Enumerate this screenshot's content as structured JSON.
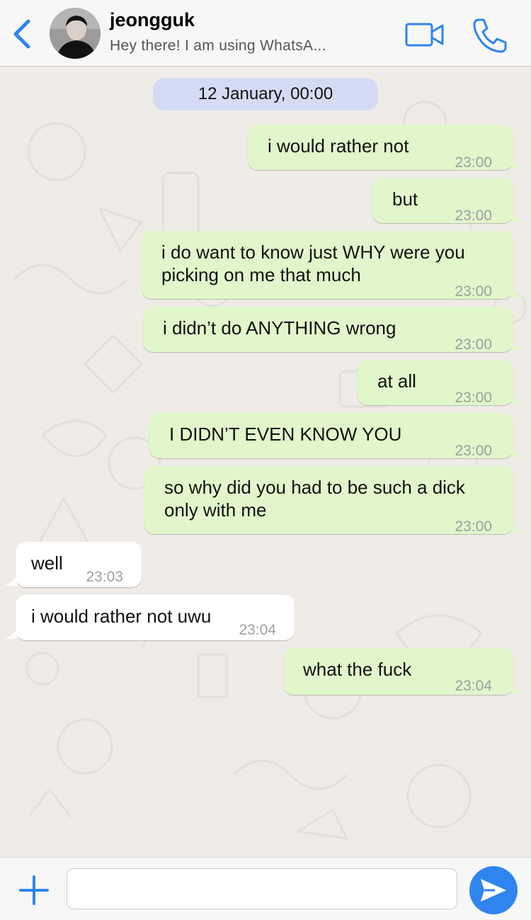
{
  "header": {
    "contact_name": "jeongguk",
    "status": "Hey there! I am using WhatsA...",
    "accent_color": "#2f84ee",
    "icons": [
      "back-chevron-icon",
      "avatar",
      "video-call-icon",
      "phone-call-icon"
    ]
  },
  "chat": {
    "date_chip": "12 January, 00:00",
    "outgoing_color": "#e1f6cb",
    "incoming_color": "#ffffff",
    "messages": [
      {
        "dir": "out",
        "lines": [
          "i would rather not"
        ],
        "time": "23:00"
      },
      {
        "dir": "out",
        "lines": [
          "but"
        ],
        "time": "23:00"
      },
      {
        "dir": "out",
        "lines": [
          "i do want to know just WHY were you",
          "picking on me that much"
        ],
        "time": "23:00"
      },
      {
        "dir": "out",
        "lines": [
          "i didn’t do ANYTHING wrong"
        ],
        "time": "23:00"
      },
      {
        "dir": "out",
        "lines": [
          "at all"
        ],
        "time": "23:00"
      },
      {
        "dir": "out",
        "lines": [
          "I DIDN’T EVEN KNOW YOU"
        ],
        "time": "23:00"
      },
      {
        "dir": "out",
        "lines": [
          "so why did you had to be such a dick",
          "only with me"
        ],
        "time": "23:00"
      },
      {
        "dir": "in",
        "lines": [
          "well"
        ],
        "time": "23:03"
      },
      {
        "dir": "in",
        "lines": [
          "i would rather not uwu"
        ],
        "time": "23:04"
      },
      {
        "dir": "out",
        "lines": [
          "what the fuck"
        ],
        "time": "23:04"
      }
    ]
  },
  "composer": {
    "input_value": "",
    "icons": [
      "plus-icon",
      "send-icon"
    ]
  }
}
